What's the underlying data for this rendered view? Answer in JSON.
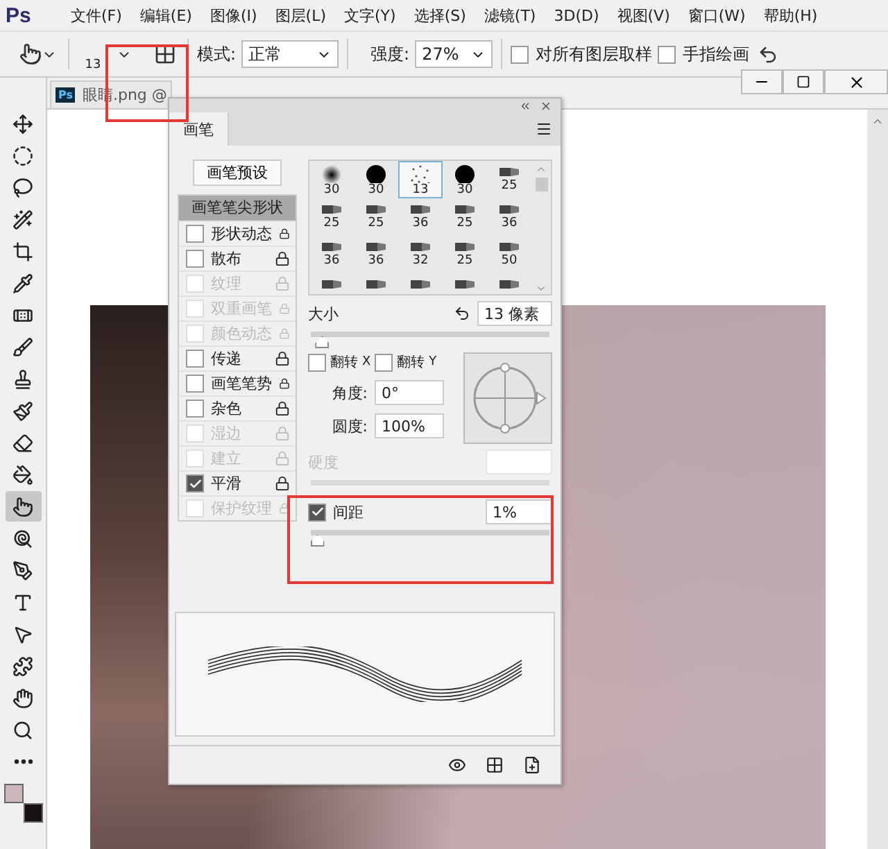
{
  "logo": "Ps",
  "menu": [
    "文件(F)",
    "编辑(E)",
    "图像(I)",
    "图层(L)",
    "文字(Y)",
    "选择(S)",
    "滤镜(T)",
    "3D(D)",
    "视图(V)",
    "窗口(W)",
    "帮助(H)"
  ],
  "options_bar": {
    "brush_size": "13",
    "mode": {
      "label": "模式:",
      "value": "正常"
    },
    "strength": {
      "label": "强度:",
      "value": "27%"
    },
    "checkboxes": [
      {
        "label": "对所有图层取样",
        "checked": false
      },
      {
        "label": "手指绘画",
        "checked": false
      }
    ]
  },
  "tools": [
    {
      "selected": false
    },
    {
      "selected": false
    },
    {
      "selected": false
    },
    {
      "selected": false
    },
    {
      "selected": false
    },
    {
      "selected": false
    },
    {
      "selected": false
    },
    {
      "selected": false
    },
    {
      "selected": false
    },
    {
      "selected": false
    },
    {
      "selected": false
    },
    {
      "selected": false
    },
    {
      "selected": true
    },
    {
      "selected": false
    },
    {
      "selected": false
    },
    {
      "selected": false
    },
    {
      "selected": false
    },
    {
      "selected": false
    },
    {
      "selected": false
    },
    {
      "selected": false
    },
    {
      "selected": false
    }
  ],
  "swatches": [
    {
      "color": "#cdb6b9"
    },
    {
      "color": "#141014"
    }
  ],
  "document": {
    "icon": "Ps",
    "title": "眼睛.png @"
  },
  "brush_panel": {
    "tab": "画笔",
    "presets_button": "画笔预设",
    "tip_shape": {
      "label": "画笔笔尖形状",
      "selected": true
    },
    "options": [
      {
        "label": "形状动态",
        "checked": false,
        "disabled": false
      },
      {
        "label": "散布",
        "checked": false,
        "disabled": false
      },
      {
        "label": "纹理",
        "checked": false,
        "disabled": true
      },
      {
        "label": "双重画笔",
        "checked": false,
        "disabled": true
      },
      {
        "label": "颜色动态",
        "checked": false,
        "disabled": true
      },
      {
        "label": "传递",
        "checked": false,
        "disabled": false
      },
      {
        "label": "画笔笔势",
        "checked": false,
        "disabled": false
      },
      {
        "label": "杂色",
        "checked": false,
        "disabled": false
      },
      {
        "label": "湿边",
        "checked": false,
        "disabled": true
      },
      {
        "label": "建立",
        "checked": false,
        "disabled": true
      },
      {
        "label": "平滑",
        "checked": true,
        "disabled": false
      },
      {
        "label": "保护纹理",
        "checked": false,
        "disabled": true
      }
    ],
    "tips": [
      {
        "kind": "soft",
        "size": "30",
        "selected": false
      },
      {
        "kind": "hard",
        "size": "30",
        "selected": false
      },
      {
        "kind": "scatter",
        "size": "13",
        "selected": true
      },
      {
        "kind": "hard",
        "size": "30",
        "selected": false
      },
      {
        "kind": "tip",
        "size": "25",
        "selected": false
      },
      {
        "kind": "tip",
        "size": "25",
        "selected": false
      },
      {
        "kind": "tip",
        "size": "25",
        "selected": false
      },
      {
        "kind": "tip",
        "size": "36",
        "selected": false
      },
      {
        "kind": "tip",
        "size": "25",
        "selected": false
      },
      {
        "kind": "tip",
        "size": "36",
        "selected": false
      },
      {
        "kind": "tip",
        "size": "36",
        "selected": false
      },
      {
        "kind": "tip",
        "size": "36",
        "selected": false
      },
      {
        "kind": "tip",
        "size": "32",
        "selected": false
      },
      {
        "kind": "tip",
        "size": "25",
        "selected": false
      },
      {
        "kind": "tip",
        "size": "50",
        "selected": false
      },
      {
        "kind": "tip",
        "selected": false
      },
      {
        "kind": "tip",
        "selected": false
      },
      {
        "kind": "tip",
        "selected": false
      },
      {
        "kind": "tip",
        "selected": false
      },
      {
        "kind": "tip",
        "selected": false
      }
    ],
    "size": {
      "label": "大小",
      "value": "13 像素",
      "level": 0.03
    },
    "flip": [
      {
        "label": "翻转",
        "axis": "X",
        "checked": false
      },
      {
        "label": "翻转",
        "axis": "Y",
        "checked": false
      }
    ],
    "angle": {
      "label": "角度:",
      "value": "0°"
    },
    "roundness": {
      "label": "圆度:",
      "value": "100%"
    },
    "hardness": {
      "label": "硬度",
      "disabled": true
    },
    "spacing": {
      "label": "间距",
      "checked": true,
      "value": "1%",
      "level": 0.01
    }
  }
}
